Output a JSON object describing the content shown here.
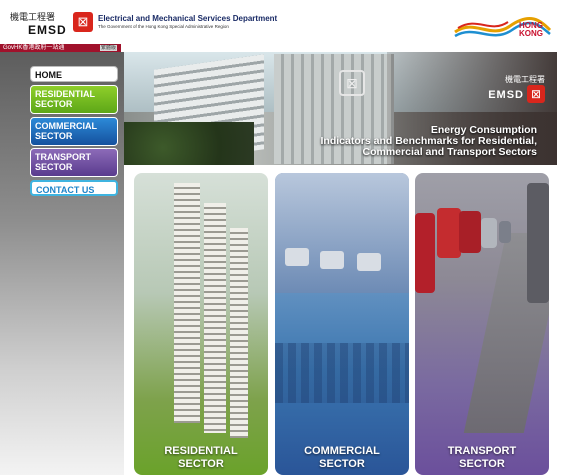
{
  "header": {
    "logo_chinese": "機電工程署",
    "logo_english": "EMSD",
    "department_name": "Electrical and Mechanical Services Department",
    "department_subtitle": "The Government of the Hong Kong Special Administrative Region",
    "brand_text": "HONG\nKONG"
  },
  "gov_bar": {
    "gov_link": "GovHK香港政府一站通",
    "language_button": "繁體版"
  },
  "sidebar": {
    "items": [
      {
        "label": "HOME"
      },
      {
        "label": "RESIDENTIAL SECTOR"
      },
      {
        "label": "COMMERCIAL SECTOR"
      },
      {
        "label": "TRANSPORT SECTOR"
      },
      {
        "label": "CONTACT US"
      }
    ]
  },
  "banner": {
    "logo_chinese": "機電工程署",
    "logo_english": "EMSD",
    "title_line1": "Energy Consumption",
    "title_line2": "Indicators and Benchmarks for Residential,",
    "title_line3": "Commercial and Transport Sectors"
  },
  "panels": [
    {
      "label_line1": "RESIDENTIAL",
      "label_line2": "SECTOR"
    },
    {
      "label_line1": "COMMERCIAL",
      "label_line2": "SECTOR"
    },
    {
      "label_line1": "TRANSPORT",
      "label_line2": "SECTOR"
    }
  ],
  "colors": {
    "residential": "#6aa22a",
    "commercial": "#1e66b3",
    "transport": "#6b4f9c",
    "gov_bar": "#a0112b",
    "emsd_red": "#d9261c"
  }
}
